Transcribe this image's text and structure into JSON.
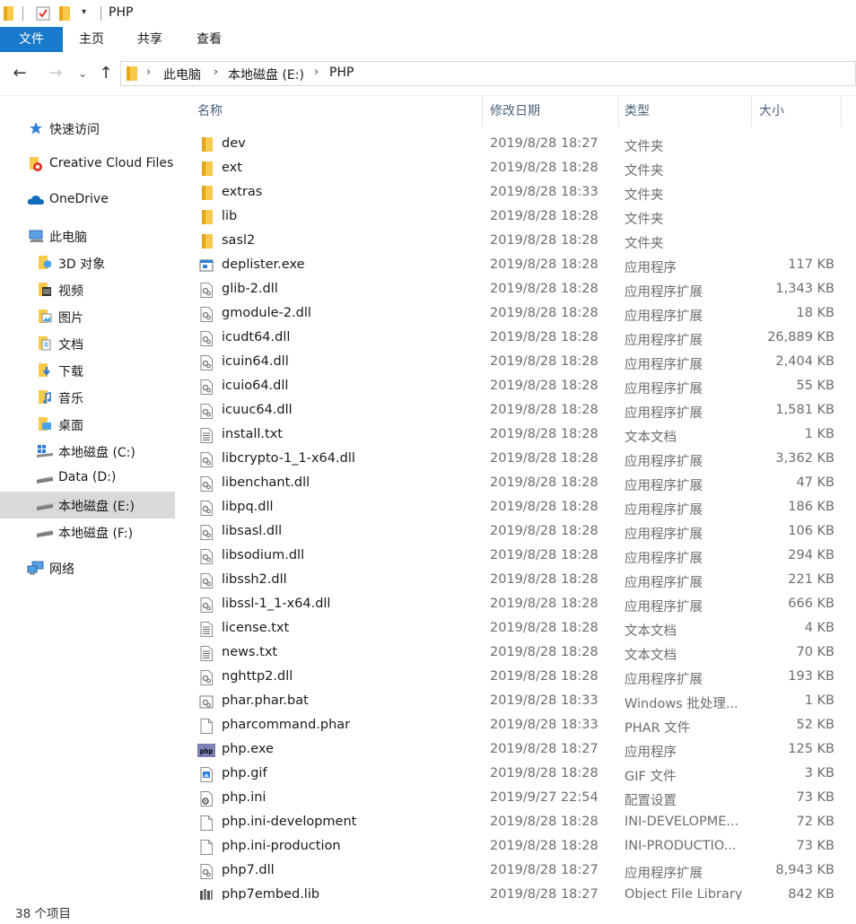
{
  "window": {
    "title": "PHP"
  },
  "ribbon": {
    "tabs": [
      "文件",
      "主页",
      "共享",
      "查看"
    ]
  },
  "address": {
    "parts": [
      "此电脑",
      "本地磁盘 (E:)",
      "PHP"
    ]
  },
  "columns": {
    "name": "名称",
    "date": "修改日期",
    "type": "类型",
    "size": "大小"
  },
  "nav_pane": [
    {
      "label": "快速访问",
      "icon": "star-icon"
    },
    {
      "label": "Creative Cloud Files",
      "icon": "creative-cloud-icon"
    },
    {
      "label": "OneDrive",
      "icon": "cloud-icon"
    },
    {
      "label": "此电脑",
      "icon": "computer-icon"
    },
    {
      "label": "3D 对象",
      "icon": "folder-3d-icon"
    },
    {
      "label": "视频",
      "icon": "folder-video-icon"
    },
    {
      "label": "图片",
      "icon": "folder-pictures-icon"
    },
    {
      "label": "文档",
      "icon": "folder-documents-icon"
    },
    {
      "label": "下载",
      "icon": "folder-downloads-icon"
    },
    {
      "label": "音乐",
      "icon": "folder-music-icon"
    },
    {
      "label": "桌面",
      "icon": "folder-desktop-icon"
    },
    {
      "label": "本地磁盘 (C:)",
      "icon": "windows-drive-icon"
    },
    {
      "label": "Data (D:)",
      "icon": "drive-icon"
    },
    {
      "label": "本地磁盘 (E:)",
      "icon": "drive-icon",
      "selected": true
    },
    {
      "label": "本地磁盘 (F:)",
      "icon": "drive-icon"
    },
    {
      "label": "网络",
      "icon": "network-icon"
    }
  ],
  "files": [
    {
      "name": "dev",
      "date": "2019/8/28 18:27",
      "type": "文件夹",
      "size": "",
      "icon": "folder-icon"
    },
    {
      "name": "ext",
      "date": "2019/8/28 18:28",
      "type": "文件夹",
      "size": "",
      "icon": "folder-icon"
    },
    {
      "name": "extras",
      "date": "2019/8/28 18:33",
      "type": "文件夹",
      "size": "",
      "icon": "folder-icon"
    },
    {
      "name": "lib",
      "date": "2019/8/28 18:28",
      "type": "文件夹",
      "size": "",
      "icon": "folder-icon"
    },
    {
      "name": "sasl2",
      "date": "2019/8/28 18:28",
      "type": "文件夹",
      "size": "",
      "icon": "folder-icon"
    },
    {
      "name": "deplister.exe",
      "date": "2019/8/28 18:28",
      "type": "应用程序",
      "size": "117 KB",
      "icon": "exe-icon"
    },
    {
      "name": "glib-2.dll",
      "date": "2019/8/28 18:28",
      "type": "应用程序扩展",
      "size": "1,343 KB",
      "icon": "dll-icon"
    },
    {
      "name": "gmodule-2.dll",
      "date": "2019/8/28 18:28",
      "type": "应用程序扩展",
      "size": "18 KB",
      "icon": "dll-icon"
    },
    {
      "name": "icudt64.dll",
      "date": "2019/8/28 18:28",
      "type": "应用程序扩展",
      "size": "26,889 KB",
      "icon": "dll-icon"
    },
    {
      "name": "icuin64.dll",
      "date": "2019/8/28 18:28",
      "type": "应用程序扩展",
      "size": "2,404 KB",
      "icon": "dll-icon"
    },
    {
      "name": "icuio64.dll",
      "date": "2019/8/28 18:28",
      "type": "应用程序扩展",
      "size": "55 KB",
      "icon": "dll-icon"
    },
    {
      "name": "icuuc64.dll",
      "date": "2019/8/28 18:28",
      "type": "应用程序扩展",
      "size": "1,581 KB",
      "icon": "dll-icon"
    },
    {
      "name": "install.txt",
      "date": "2019/8/28 18:28",
      "type": "文本文档",
      "size": "1 KB",
      "icon": "text-file-icon"
    },
    {
      "name": "libcrypto-1_1-x64.dll",
      "date": "2019/8/28 18:28",
      "type": "应用程序扩展",
      "size": "3,362 KB",
      "icon": "dll-icon"
    },
    {
      "name": "libenchant.dll",
      "date": "2019/8/28 18:28",
      "type": "应用程序扩展",
      "size": "47 KB",
      "icon": "dll-icon"
    },
    {
      "name": "libpq.dll",
      "date": "2019/8/28 18:28",
      "type": "应用程序扩展",
      "size": "186 KB",
      "icon": "dll-icon"
    },
    {
      "name": "libsasl.dll",
      "date": "2019/8/28 18:28",
      "type": "应用程序扩展",
      "size": "106 KB",
      "icon": "dll-icon"
    },
    {
      "name": "libsodium.dll",
      "date": "2019/8/28 18:28",
      "type": "应用程序扩展",
      "size": "294 KB",
      "icon": "dll-icon"
    },
    {
      "name": "libssh2.dll",
      "date": "2019/8/28 18:28",
      "type": "应用程序扩展",
      "size": "221 KB",
      "icon": "dll-icon"
    },
    {
      "name": "libssl-1_1-x64.dll",
      "date": "2019/8/28 18:28",
      "type": "应用程序扩展",
      "size": "666 KB",
      "icon": "dll-icon"
    },
    {
      "name": "license.txt",
      "date": "2019/8/28 18:28",
      "type": "文本文档",
      "size": "4 KB",
      "icon": "text-file-icon"
    },
    {
      "name": "news.txt",
      "date": "2019/8/28 18:28",
      "type": "文本文档",
      "size": "70 KB",
      "icon": "text-file-icon"
    },
    {
      "name": "nghttp2.dll",
      "date": "2019/8/28 18:28",
      "type": "应用程序扩展",
      "size": "193 KB",
      "icon": "dll-icon"
    },
    {
      "name": "phar.phar.bat",
      "date": "2019/8/28 18:33",
      "type": "Windows 批处理...",
      "size": "1 KB",
      "icon": "bat-icon"
    },
    {
      "name": "pharcommand.phar",
      "date": "2019/8/28 18:33",
      "type": "PHAR 文件",
      "size": "52 KB",
      "icon": "blank-file-icon"
    },
    {
      "name": "php.exe",
      "date": "2019/8/28 18:27",
      "type": "应用程序",
      "size": "125 KB",
      "icon": "php-exe-icon"
    },
    {
      "name": "php.gif",
      "date": "2019/8/28 18:28",
      "type": "GIF 文件",
      "size": "3 KB",
      "icon": "image-file-icon"
    },
    {
      "name": "php.ini",
      "date": "2019/9/27 22:54",
      "type": "配置设置",
      "size": "73 KB",
      "icon": "ini-file-icon"
    },
    {
      "name": "php.ini-development",
      "date": "2019/8/28 18:28",
      "type": "INI-DEVELOPME...",
      "size": "72 KB",
      "icon": "blank-file-icon"
    },
    {
      "name": "php.ini-production",
      "date": "2019/8/28 18:28",
      "type": "INI-PRODUCTIO...",
      "size": "73 KB",
      "icon": "blank-file-icon"
    },
    {
      "name": "php7.dll",
      "date": "2019/8/28 18:27",
      "type": "应用程序扩展",
      "size": "8,943 KB",
      "icon": "dll-icon"
    },
    {
      "name": "php7embed.lib",
      "date": "2019/8/28 18:27",
      "type": "Object File Library",
      "size": "842 KB",
      "icon": "lib-file-icon"
    }
  ],
  "status": {
    "item_count": "38 个项目"
  },
  "colors": {
    "accent": "#1979ca",
    "selected_bg": "#d9d9d9",
    "folder": "#f8c94a",
    "header_text": "#4c607a"
  }
}
